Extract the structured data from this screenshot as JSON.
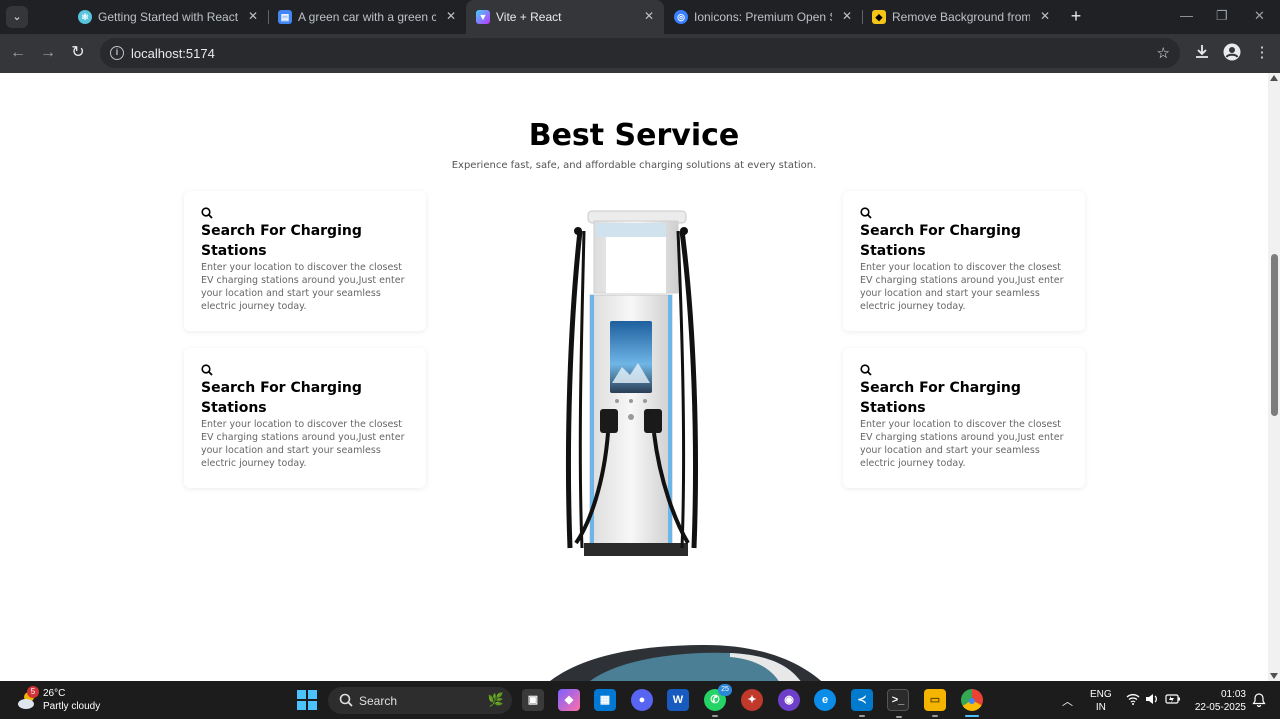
{
  "browser": {
    "tabs": [
      {
        "title": "Getting Started with React",
        "favicon": "react-icon",
        "active": false
      },
      {
        "title": "A green car with a green car plug",
        "favicon": "docs-icon",
        "active": false
      },
      {
        "title": "Vite + React",
        "favicon": "vite-icon",
        "active": true
      },
      {
        "title": "Ionicons: Premium Open Source Icons",
        "favicon": "ionicons-icon",
        "active": false
      },
      {
        "title": "Remove Background from Image",
        "favicon": "removebg-icon",
        "active": false
      }
    ],
    "url": "localhost:5174",
    "colors": {
      "frame": "#202124",
      "toolbar": "#35363a",
      "omnibox": "#282a2d"
    }
  },
  "page": {
    "title": "Best Service",
    "subtitle": "Experience fast, safe, and affordable charging solutions at every station.",
    "cards": [
      {
        "icon": "search-icon",
        "title": "Search For Charging Stations",
        "description": "Enter your location to discover the closest EV charging stations around you,Just enter your location and start your seamless electric journey today."
      },
      {
        "icon": "search-icon",
        "title": "Search For Charging Stations",
        "description": "Enter your location to discover the closest EV charging stations around you,Just enter your location and start your seamless electric journey today."
      },
      {
        "icon": "search-icon",
        "title": "Search For Charging Stations",
        "description": "Enter your location to discover the closest EV charging stations around you,Just enter your location and start your seamless electric journey today."
      },
      {
        "icon": "search-icon",
        "title": "Search For Charging Stations",
        "description": "Enter your location to discover the closest EV charging stations around you,Just enter your location and start your seamless electric journey today."
      }
    ]
  },
  "taskbar": {
    "weather": {
      "temp": "26°C",
      "desc": "Partly cloudy",
      "badge": "5"
    },
    "search_label": "Search",
    "apps": [
      {
        "name": "task-view",
        "color": "#3a3a3a"
      },
      {
        "name": "copilot",
        "color": "#7b61ff"
      },
      {
        "name": "microsoft-store",
        "color": "#0078d4"
      },
      {
        "name": "discord",
        "color": "#5865f2"
      },
      {
        "name": "word",
        "color": "#185abd"
      },
      {
        "name": "whatsapp",
        "color": "#25d366",
        "badge": "25"
      },
      {
        "name": "brave",
        "color": "#c0392b"
      },
      {
        "name": "github",
        "color": "#6e40c9"
      },
      {
        "name": "edge",
        "color": "#0c8ce9"
      },
      {
        "name": "vscode",
        "color": "#007acc"
      },
      {
        "name": "terminal",
        "color": "#2b2b2b"
      },
      {
        "name": "file-explorer",
        "color": "#f4b400"
      },
      {
        "name": "chrome",
        "color": "#34a853"
      }
    ],
    "lang": {
      "line1": "ENG",
      "line2": "IN"
    },
    "time": "01:03",
    "date": "22-05-2025"
  }
}
